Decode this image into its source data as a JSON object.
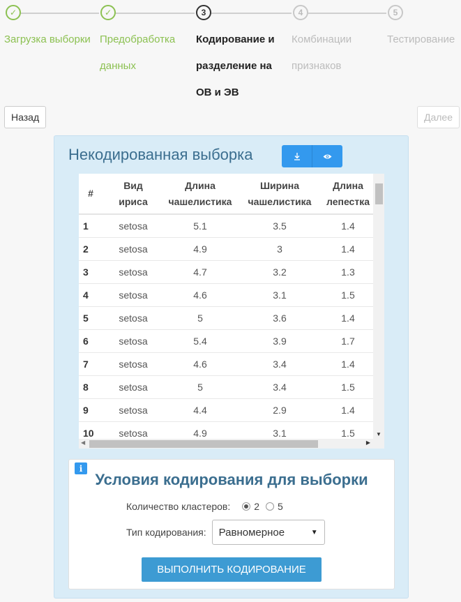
{
  "stepper": {
    "steps": [
      {
        "number": "1",
        "state": "done",
        "lines": [
          "Загрузка выборки"
        ]
      },
      {
        "number": "2",
        "state": "done",
        "lines": [
          "Предобработка",
          "данных"
        ]
      },
      {
        "number": "3",
        "state": "active",
        "lines": [
          "Кодирование и",
          "разделение на",
          "ОВ и ЭВ"
        ]
      },
      {
        "number": "4",
        "state": "todo",
        "lines": [
          "Комбинации",
          "признаков"
        ]
      },
      {
        "number": "5",
        "state": "todo",
        "lines": [
          "Тестирование"
        ]
      }
    ],
    "check_glyph": "✓"
  },
  "nav": {
    "back_label": "Назад",
    "next_label": "Далее"
  },
  "panel": {
    "title": "Некодированная выборка",
    "download_icon": "download-icon",
    "view_icon": "eye-icon",
    "table": {
      "headers": [
        [
          "#"
        ],
        [
          "Вид",
          "ириса"
        ],
        [
          "Длина",
          "чашелистика"
        ],
        [
          "Ширина",
          "чашелистика"
        ],
        [
          "Длина",
          "лепестка"
        ]
      ],
      "rows": [
        [
          "1",
          "setosa",
          "5.1",
          "3.5",
          "1.4"
        ],
        [
          "2",
          "setosa",
          "4.9",
          "3",
          "1.4"
        ],
        [
          "3",
          "setosa",
          "4.7",
          "3.2",
          "1.3"
        ],
        [
          "4",
          "setosa",
          "4.6",
          "3.1",
          "1.5"
        ],
        [
          "5",
          "setosa",
          "5",
          "3.6",
          "1.4"
        ],
        [
          "6",
          "setosa",
          "5.4",
          "3.9",
          "1.7"
        ],
        [
          "7",
          "setosa",
          "4.6",
          "3.4",
          "1.4"
        ],
        [
          "8",
          "setosa",
          "5",
          "3.4",
          "1.5"
        ],
        [
          "9",
          "setosa",
          "4.4",
          "2.9",
          "1.4"
        ],
        [
          "10",
          "setosa",
          "4.9",
          "3.1",
          "1.5"
        ]
      ]
    }
  },
  "conditions": {
    "info_label": "i",
    "title": "Условия кодирования для выборки",
    "clusters_label": "Количество кластеров:",
    "cluster_options": [
      "2",
      "5"
    ],
    "cluster_selected": "2",
    "type_label": "Тип кодирования:",
    "type_value": "Равномерное",
    "run_label": "ВЫПОЛНИТЬ КОДИРОВАНИЕ"
  },
  "colors": {
    "done": "#8cc152",
    "accent": "#3399ee",
    "panel_bg": "#d9ecf7",
    "title": "#3b6e8f"
  }
}
